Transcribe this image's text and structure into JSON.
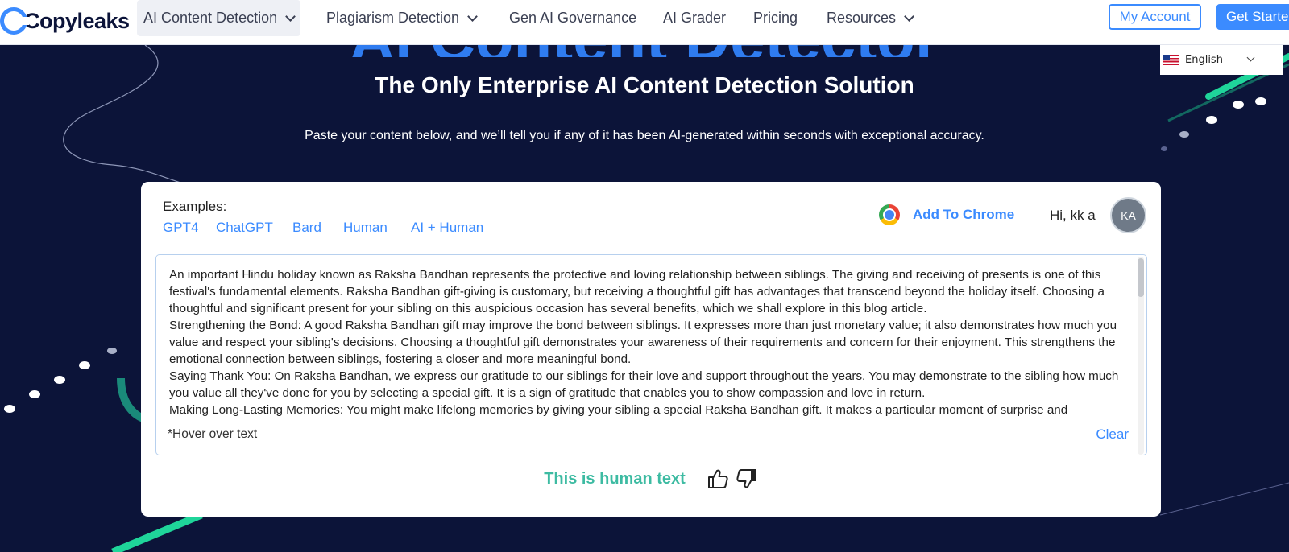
{
  "nav": {
    "logo_text": "Copyleaks",
    "items": [
      {
        "label": "AI Content Detection",
        "has_dropdown": true,
        "active": true
      },
      {
        "label": "Plagiarism Detection",
        "has_dropdown": true,
        "active": false
      },
      {
        "label": "Gen AI Governance",
        "has_dropdown": false,
        "active": false
      },
      {
        "label": "AI Grader",
        "has_dropdown": false,
        "active": false
      },
      {
        "label": "Pricing",
        "has_dropdown": false,
        "active": false
      },
      {
        "label": "Resources",
        "has_dropdown": true,
        "active": false
      }
    ],
    "my_account": "My Account",
    "get_started": "Get Starte"
  },
  "language": {
    "label": "English",
    "flag": "us-flag-icon"
  },
  "hero": {
    "ghost_title": "AI Content Detector",
    "title": "The Only Enterprise AI Content Detection Solution",
    "subtitle": "Paste your content below, and we’ll tell you if any of it has been AI-generated within seconds with exceptional accuracy."
  },
  "card": {
    "examples_label": "Examples:",
    "examples": [
      "GPT4",
      "ChatGPT",
      "Bard",
      "Human",
      "AI + Human"
    ],
    "add_to_chrome": "Add To Chrome",
    "greeting": "Hi, kk a",
    "avatar_initials": "KA",
    "editor_lines": [
      "An important Hindu holiday known as Raksha Bandhan represents the protective and loving relationship between siblings. The giving and receiving of presents is one of this festival's fundamental elements. Raksha Bandhan gift-giving is customary, but receiving a thoughtful gift has advantages that transcend beyond the holiday itself. Choosing a thoughtful and significant present for your sibling on this auspicious occasion has several benefits, which we shall explore in this blog article.",
      "Strengthening the Bond: A good Raksha Bandhan gift may improve the bond between siblings. It expresses more than just monetary value; it also demonstrates how much you value and respect your sibling's decisions. Choosing a thoughtful gift demonstrates your awareness of their requirements and concern for their enjoyment. This strengthens the emotional connection between siblings, fostering a closer and more meaningful bond.",
      "Saying Thank You: On Raksha Bandhan, we express our gratitude to our siblings for their love and support throughout the years. You may demonstrate to the sibling how much you value all they've done for you by selecting a special gift. It is a sign of gratitude that enables you to show compassion and love in return.",
      "Making Long-Lasting Memories: You might make lifelong memories by giving your sibling a special Raksha Bandhan gift. It makes a particular moment of surprise and"
    ],
    "hover_note": "*Hover over text",
    "clear": "Clear",
    "result": "This is human text"
  },
  "colors": {
    "accent": "#3b8bff",
    "background": "#0c1439",
    "result_green": "#3dbba2"
  }
}
